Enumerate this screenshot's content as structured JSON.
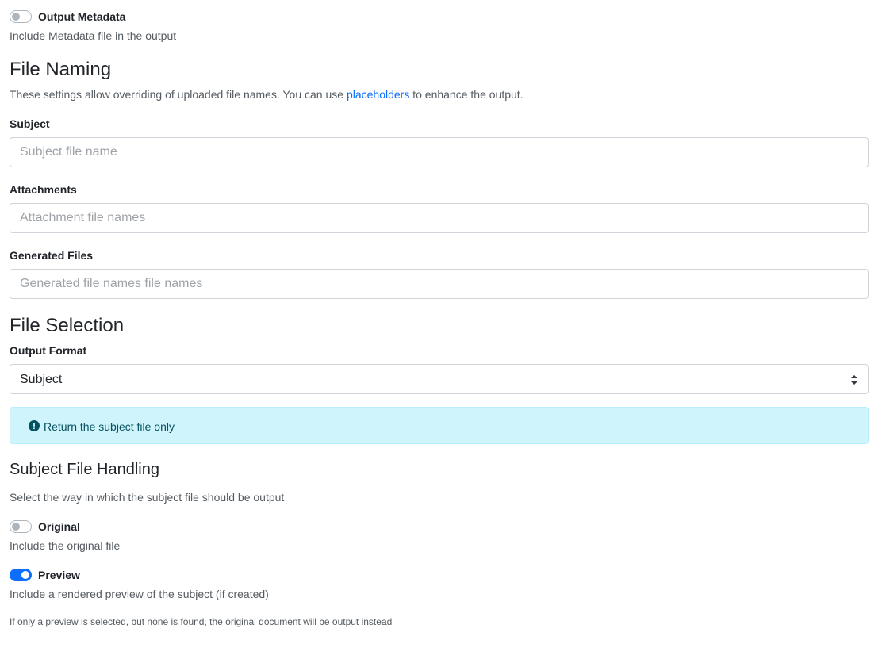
{
  "output_metadata": {
    "label": "Output Metadata",
    "help": "Include Metadata file in the output",
    "enabled": false
  },
  "file_naming": {
    "heading": "File Naming",
    "description_before": "These settings allow overriding of uploaded file names. You can use ",
    "description_link": "placeholders",
    "description_after": " to enhance the output.",
    "fields": [
      {
        "label": "Subject",
        "placeholder": "Subject file name",
        "value": ""
      },
      {
        "label": "Attachments",
        "placeholder": "Attachment file names",
        "value": ""
      },
      {
        "label": "Generated Files",
        "placeholder": "Generated file names file names",
        "value": ""
      }
    ]
  },
  "file_selection": {
    "heading": "File Selection",
    "output_format_label": "Output Format",
    "output_format_value": "Subject",
    "info": "Return the subject file only"
  },
  "subject_handling": {
    "heading": "Subject File Handling",
    "description": "Select the way in which the subject file should be output",
    "options": [
      {
        "label": "Original",
        "help": "Include the original file",
        "enabled": false
      },
      {
        "label": "Preview",
        "help": "Include a rendered preview of the subject (if created)",
        "enabled": true
      }
    ],
    "note": "If only a preview is selected, but none is found, the original document will be output instead"
  },
  "colors": {
    "primary": "#0d6efd",
    "info_bg": "#cff4fc",
    "info_text": "#055160"
  }
}
